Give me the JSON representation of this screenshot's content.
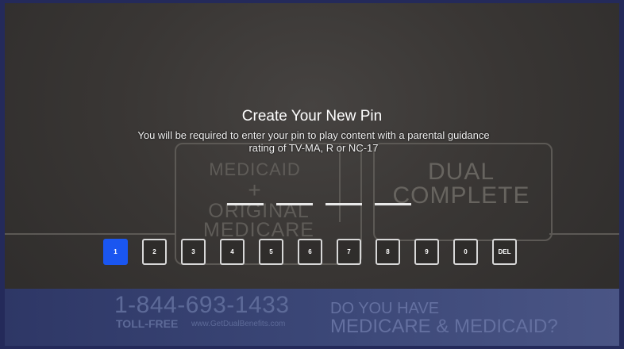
{
  "dialog": {
    "title": "Create Your New Pin",
    "subtitle": "You will be required to enter your pin to play content with a parental guidance rating of TV-MA, R or NC-17",
    "pin_length": 4,
    "entered_digits": 0
  },
  "keypad": {
    "keys": [
      "1",
      "2",
      "3",
      "4",
      "5",
      "6",
      "7",
      "8",
      "9",
      "0",
      "DEL"
    ],
    "selected_key": "1"
  },
  "background_ad": {
    "word_medicaid": "MEDICAID",
    "plus": "+",
    "word_original": "ORIGINAL",
    "word_medicare": "MEDICARE",
    "word_dual": "DUAL",
    "word_complete": "COMPLETE",
    "phone": "1-844-693-1433",
    "toll_free": "TOLL-FREE",
    "url": "www.GetDualBenefits.com",
    "question_line1": "DO YOU HAVE",
    "question_line2": "MEDICARE & MEDICAID?"
  },
  "colors": {
    "highlight": "#1a56f0",
    "overlay": "#393634",
    "text": "#ffffff"
  }
}
